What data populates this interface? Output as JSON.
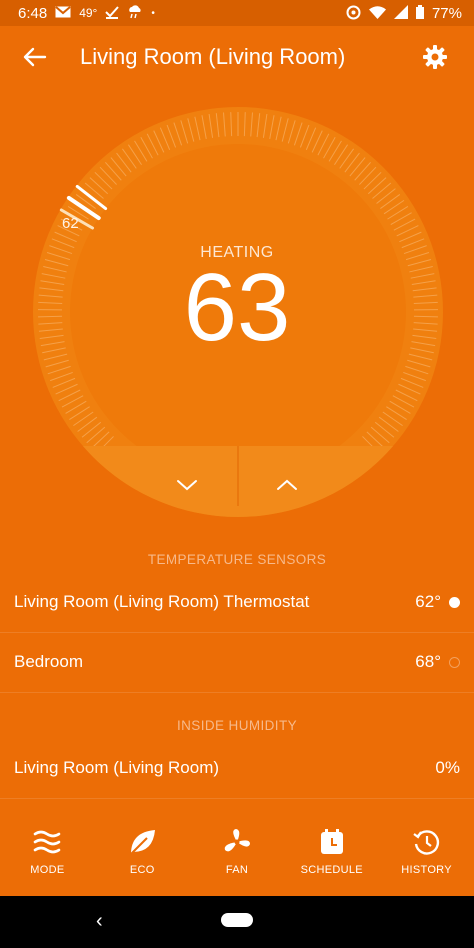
{
  "status_bar": {
    "time": "6:48",
    "temp": "49°",
    "battery": "77%",
    "dot": "•"
  },
  "header": {
    "title": "Living Room (Living Room)"
  },
  "thermostat": {
    "mode": "HEATING",
    "setpoint": "63",
    "current_temp": "62"
  },
  "sensors": {
    "heading": "TEMPERATURE SENSORS",
    "items": [
      {
        "name": "Living Room (Living Room) Thermostat",
        "value": "62°",
        "active": true
      },
      {
        "name": "Bedroom",
        "value": "68°",
        "active": false
      }
    ]
  },
  "humidity": {
    "heading": "INSIDE HUMIDITY",
    "items": [
      {
        "name": "Living Room (Living Room)",
        "value": "0%"
      }
    ]
  },
  "nav": {
    "items": [
      {
        "label": "MODE",
        "icon": "mode-icon"
      },
      {
        "label": "ECO",
        "icon": "leaf-icon"
      },
      {
        "label": "FAN",
        "icon": "fan-icon"
      },
      {
        "label": "SCHEDULE",
        "icon": "schedule-icon"
      },
      {
        "label": "HISTORY",
        "icon": "history-icon"
      }
    ]
  },
  "colors": {
    "background": "#ec6d06",
    "status_bar": "#d75f00",
    "accent_text": "#f7b98a"
  }
}
